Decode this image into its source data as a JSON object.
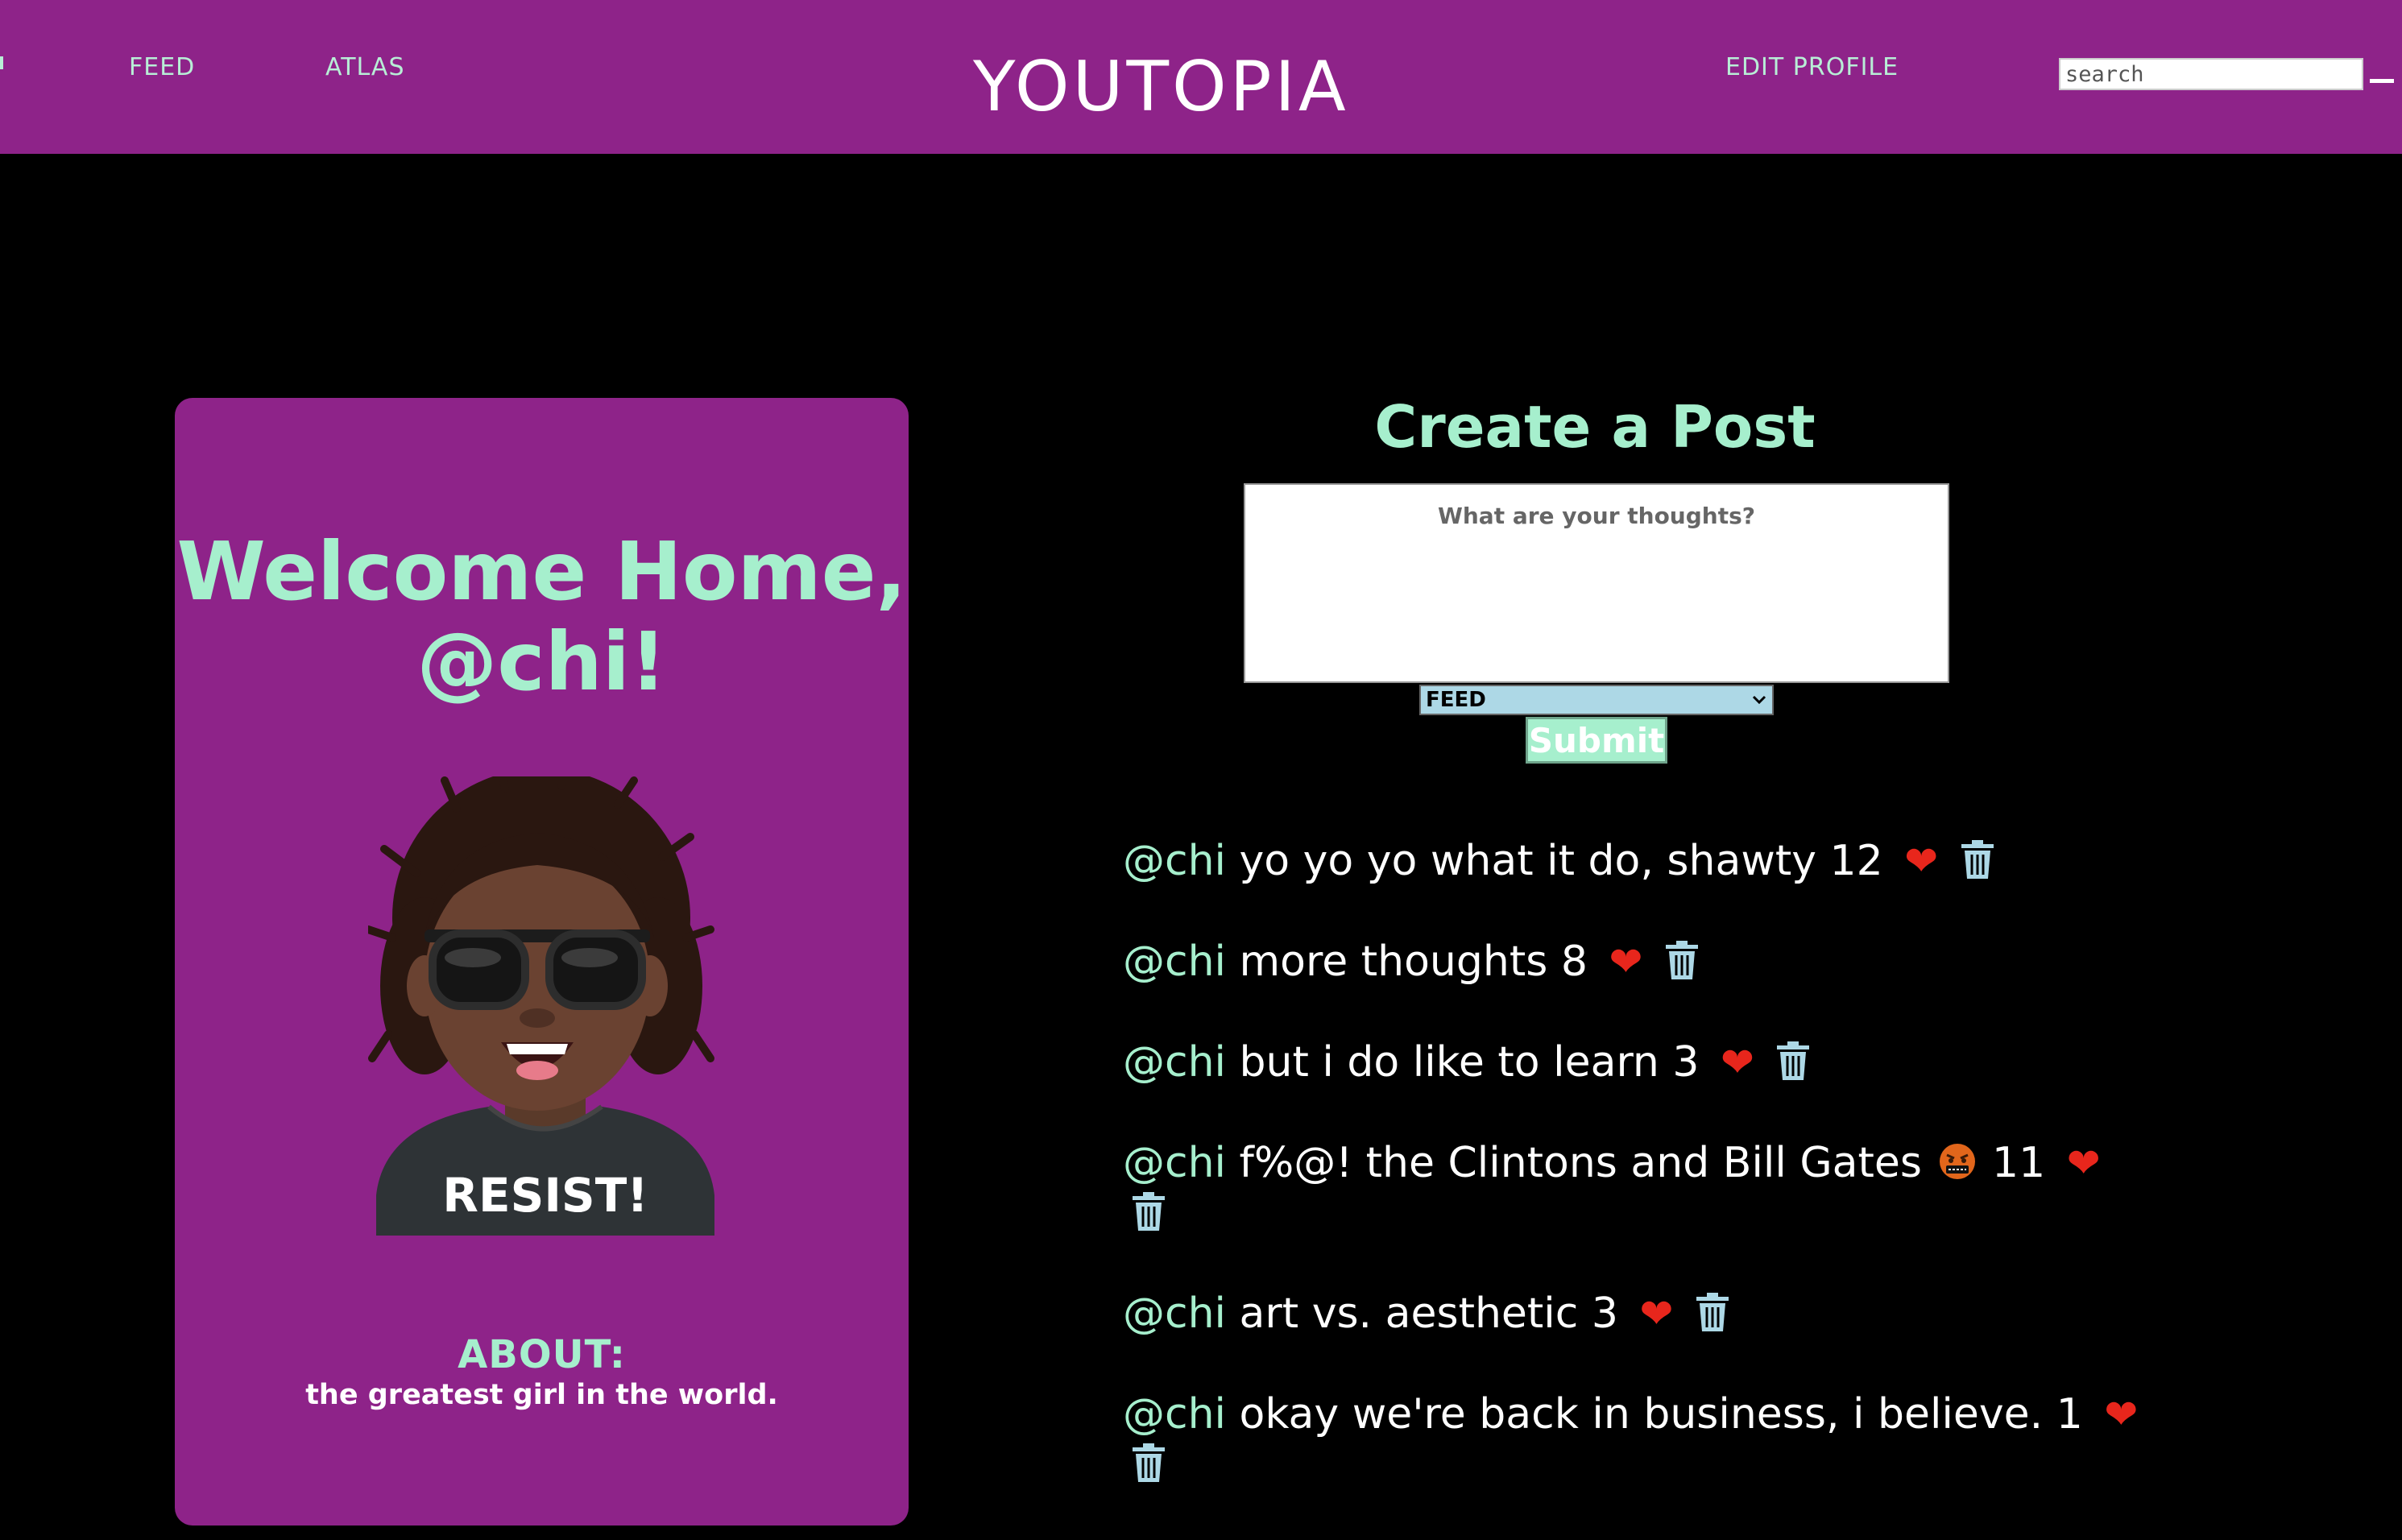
{
  "nav": {
    "feed": "FEED",
    "atlas": "ATLAS",
    "brand": "YOUTOPIA",
    "edit_profile": "EDIT PROFILE",
    "search_placeholder": "search"
  },
  "profile": {
    "welcome": "Welcome Home, @chi!",
    "about_label": "ABOUT:",
    "about_text": "the greatest girl in the world.",
    "shirt_text": "RESIST!"
  },
  "composer": {
    "title": "Create a Post",
    "placeholder": "What are your thoughts?",
    "board_selected": "FEED",
    "submit_label": "Submit"
  },
  "posts": [
    {
      "handle": "@chi",
      "text": "yo yo yo what it do, shawty",
      "likes": "12"
    },
    {
      "handle": "@chi",
      "text": "more thoughts",
      "likes": "8"
    },
    {
      "handle": "@chi",
      "text": "but i do like to learn",
      "likes": "3"
    },
    {
      "handle": "@chi",
      "text": "f%@! the Clintons and Bill Gates",
      "likes": "11",
      "emoji": "cursing-face-icon"
    },
    {
      "handle": "@chi",
      "text": "art vs. aesthetic",
      "likes": "3"
    },
    {
      "handle": "@chi",
      "text": "okay we're back in business, i believe.",
      "likes": "1"
    }
  ],
  "colors": {
    "header_bg": "#8e2389",
    "accent_mint": "#a6efcd",
    "heart": "#e8261c",
    "trash": "#add8e6"
  }
}
